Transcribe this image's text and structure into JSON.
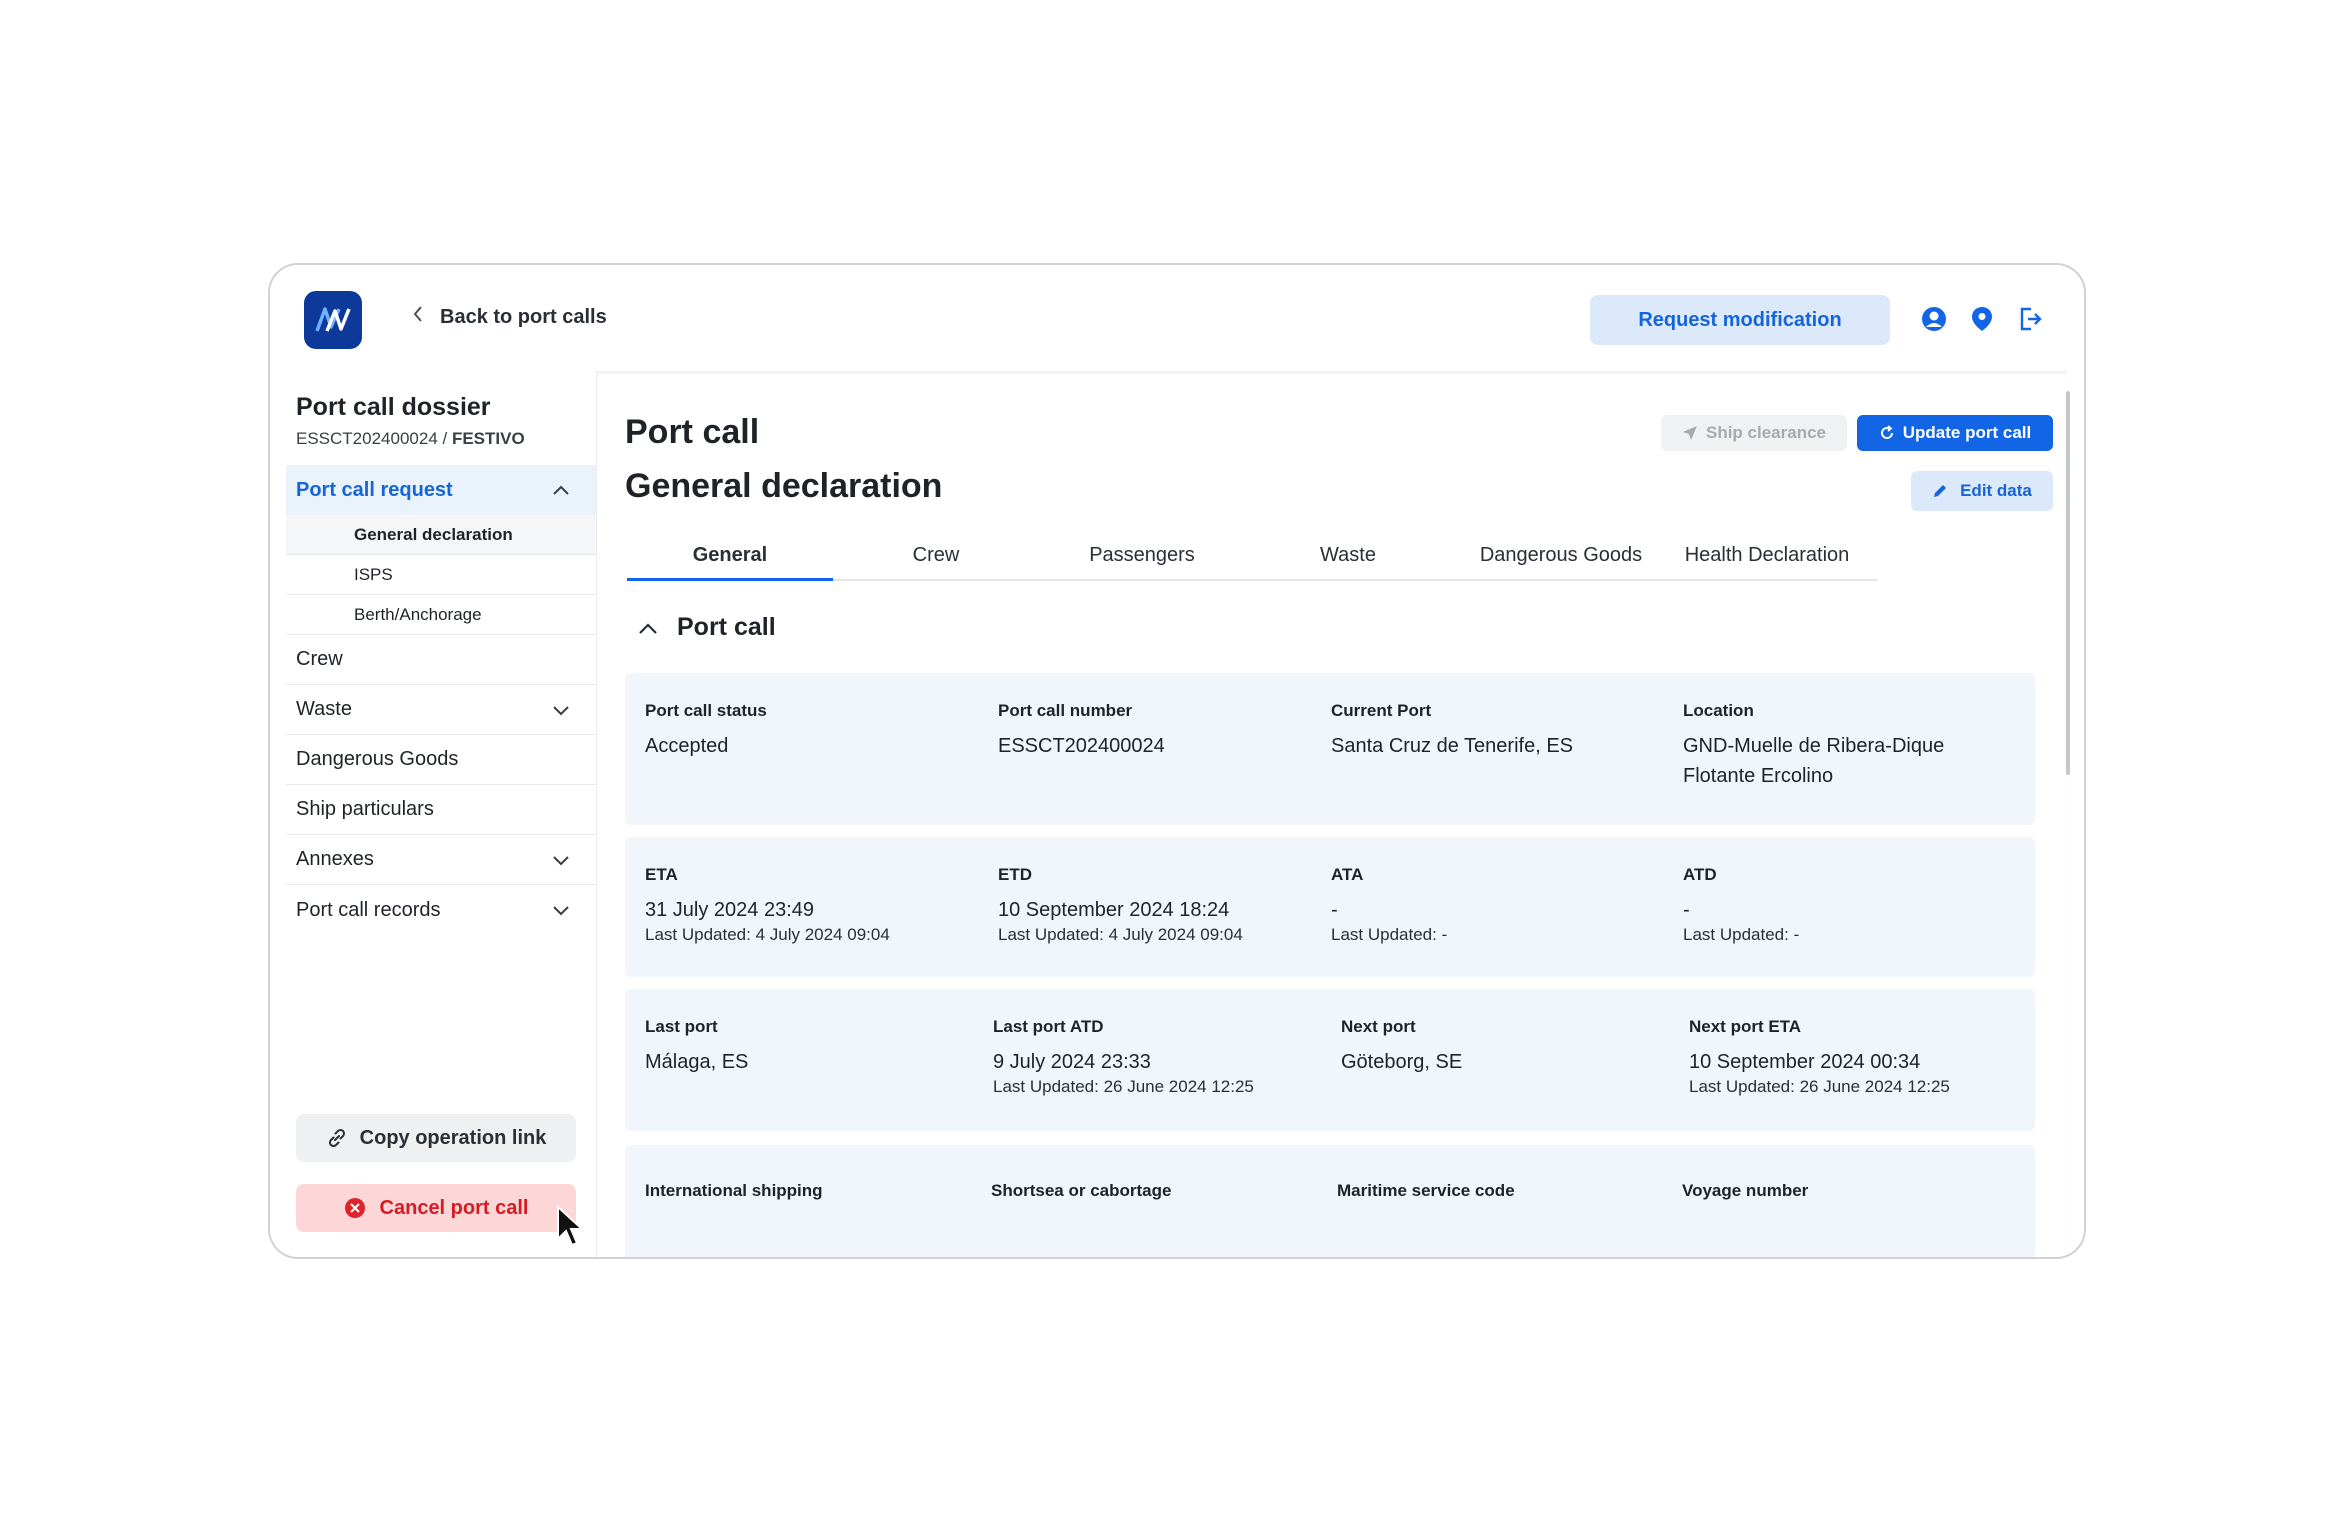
{
  "header": {
    "back_label": "Back to port calls",
    "request_modification": "Request modification",
    "icons": [
      "user-icon",
      "location-pin-icon",
      "logout-icon"
    ]
  },
  "sidebar": {
    "title": "Port call dossier",
    "dossier_id": "ESSCT202400024",
    "ship_name": "FESTIVO",
    "separator": " / ",
    "items": {
      "port_call_request": "Port call request",
      "general_declaration": "General declaration",
      "isps": "ISPS",
      "berth_anchorage": "Berth/Anchorage",
      "crew": "Crew",
      "waste": "Waste",
      "dangerous_goods": "Dangerous Goods",
      "ship_particulars": "Ship particulars",
      "annexes": "Annexes",
      "port_call_records": "Port call records"
    },
    "copy_link": "Copy operation link",
    "cancel_call": "Cancel port call"
  },
  "main": {
    "title": "Port call",
    "subtitle": "General declaration",
    "ship_clearance": "Ship clearance",
    "update_port_call": "Update port call",
    "edit_data": "Edit data",
    "tabs": [
      "General",
      "Crew",
      "Passengers",
      "Waste",
      "Dangerous Goods",
      "Health Declaration"
    ],
    "section_title": "Port call",
    "row1": {
      "status_label": "Port call status",
      "status_value": "Accepted",
      "number_label": "Port call number",
      "number_value": "ESSCT202400024",
      "current_label": "Current Port",
      "current_value": "Santa Cruz de Tenerife, ES",
      "location_label": "Location",
      "location_value_1": "GND-Muelle de Ribera-Dique",
      "location_value_2": "Flotante Ercolino"
    },
    "row2": {
      "eta_label": "ETA",
      "eta_value": "31 July 2024 23:49",
      "eta_upd": "Last Updated: 4 July 2024 09:04",
      "etd_label": "ETD",
      "etd_value": "10 September 2024 18:24",
      "etd_upd": "Last Updated: 4 July 2024 09:04",
      "ata_label": "ATA",
      "ata_value": "-",
      "ata_upd": "Last Updated: -",
      "atd_label": "ATD",
      "atd_value": "-",
      "atd_upd": "Last Updated: -"
    },
    "row3": {
      "last_port_label": "Last port",
      "last_port_value": "Málaga, ES",
      "last_atd_label": "Last port ATD",
      "last_atd_value": "9 July 2024 23:33",
      "last_atd_upd": "Last Updated: 26 June 2024 12:25",
      "next_port_label": "Next port",
      "next_port_value": "Göteborg, SE",
      "next_eta_label": "Next port ETA",
      "next_eta_value": "10 September 2024 00:34",
      "next_eta_upd": "Last Updated: 26 June 2024 12:25"
    },
    "row4": {
      "intl_label": "International shipping",
      "shortsea_label": "Shortsea or cabortage",
      "maritime_label": "Maritime service code",
      "voyage_label": "Voyage number"
    }
  },
  "colors": {
    "accent": "#1266e6",
    "accent_light": "#dbe9fb",
    "card_bg": "#f1f6fd",
    "danger": "#d81b22",
    "danger_bg": "#fdd7d8"
  }
}
